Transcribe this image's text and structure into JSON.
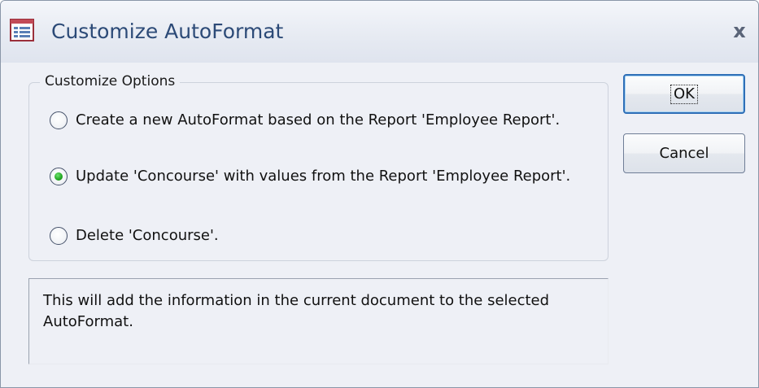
{
  "window": {
    "title": "Customize AutoFormat",
    "icon": "form-icon",
    "close_glyph": "x"
  },
  "group": {
    "legend": "Customize Options",
    "options": [
      {
        "label": "Create a new AutoFormat based on the Report 'Employee Report'.",
        "checked": false
      },
      {
        "label": "Update 'Concourse' with values from the Report 'Employee Report'.",
        "checked": true
      },
      {
        "label": "Delete 'Concourse'.",
        "checked": false
      }
    ]
  },
  "info": {
    "text": "This will add the information in the current document to the selected AutoFormat."
  },
  "buttons": {
    "ok_label": "OK",
    "cancel_label": "Cancel"
  },
  "colors": {
    "title_text": "#2c4a77",
    "radio_selected": "#21a521",
    "default_button_border": "#2f6fb7"
  }
}
